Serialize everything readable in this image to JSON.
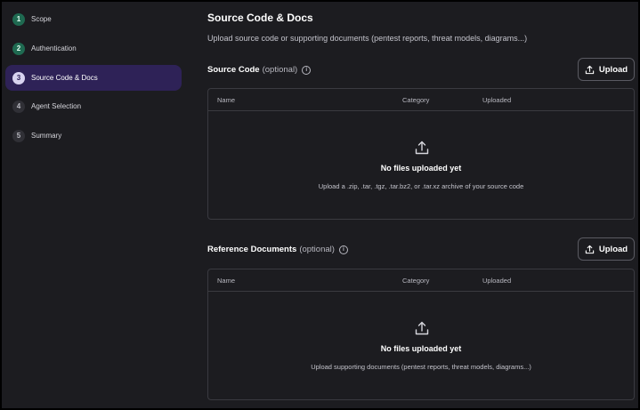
{
  "steps": [
    {
      "num": "1",
      "label": "Scope",
      "state": "done"
    },
    {
      "num": "2",
      "label": "Authentication",
      "state": "done"
    },
    {
      "num": "3",
      "label": "Source Code & Docs",
      "state": "current"
    },
    {
      "num": "4",
      "label": "Agent Selection",
      "state": "pending"
    },
    {
      "num": "5",
      "label": "Summary",
      "state": "pending"
    }
  ],
  "page": {
    "title": "Source Code & Docs",
    "subtitle": "Upload source code or supporting documents (pentest reports, threat models, diagrams...)"
  },
  "source_code": {
    "title": "Source Code",
    "optional": "(optional)",
    "info_icon": "info-icon",
    "upload_label": "Upload",
    "columns": [
      "Name",
      "Category",
      "Uploaded"
    ],
    "empty_title": "No files uploaded yet",
    "empty_desc": "Upload a .zip, .tar, .tgz, .tar.bz2, or .tar.xz archive of your source code"
  },
  "reference_docs": {
    "title": "Reference Documents",
    "optional": "(optional)",
    "info_icon": "info-icon",
    "upload_label": "Upload",
    "columns": [
      "Name",
      "Category",
      "Uploaded"
    ],
    "empty_title": "No files uploaded yet",
    "empty_desc": "Upload supporting documents (pentest reports, threat models, diagrams...)"
  },
  "colors": {
    "accent": "#2e2257",
    "done": "#1f6a51",
    "background": "#1c1c20"
  }
}
